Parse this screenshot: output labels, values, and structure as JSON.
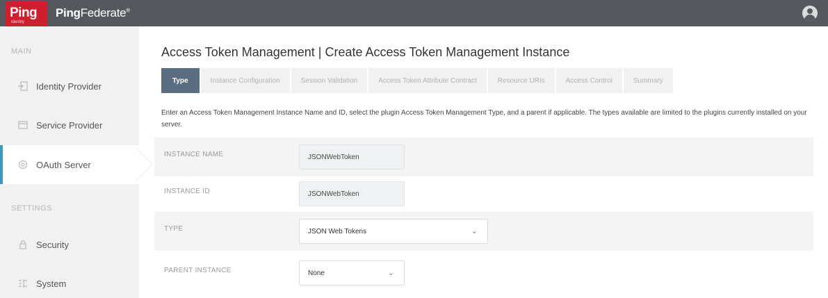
{
  "header": {
    "logo_text": "Ping",
    "logo_subtext": "identity",
    "app_name_bold": "Ping",
    "app_name_light": "Federate",
    "trademark": "®"
  },
  "sidebar": {
    "main_label": "MAIN",
    "settings_label": "SETTINGS",
    "items": [
      {
        "label": "Identity Provider",
        "icon": "identity-provider-icon"
      },
      {
        "label": "Service Provider",
        "icon": "service-provider-icon"
      },
      {
        "label": "OAuth Server",
        "icon": "oauth-server-icon",
        "active": true
      },
      {
        "label": "Security",
        "icon": "lock-icon"
      },
      {
        "label": "System",
        "icon": "system-icon"
      }
    ]
  },
  "page": {
    "title": "Access Token Management | Create Access Token Management Instance",
    "instructions": "Enter an Access Token Management Instance Name and ID, select the plugin Access Token Management Type, and a parent if applicable. The types available are limited to the plugins currently installed on your server."
  },
  "tabs": [
    {
      "label": "Type",
      "active": true
    },
    {
      "label": "Instance Configuration"
    },
    {
      "label": "Session Validation"
    },
    {
      "label": "Access Token Attribute Contract"
    },
    {
      "label": "Resource URIs"
    },
    {
      "label": "Access Control"
    },
    {
      "label": "Summary"
    }
  ],
  "form": {
    "instance_name": {
      "label": "INSTANCE NAME",
      "value": "JSONWebToken"
    },
    "instance_id": {
      "label": "INSTANCE ID",
      "value": "JSONWebToken"
    },
    "type": {
      "label": "TYPE",
      "value": "JSON Web Tokens"
    },
    "parent_instance": {
      "label": "PARENT INSTANCE",
      "value": "None"
    }
  },
  "colors": {
    "topbar": "#55595e",
    "brand_red": "#cf1f2f",
    "active_tab": "#5a6e82",
    "active_accent": "#3a9bb8"
  }
}
